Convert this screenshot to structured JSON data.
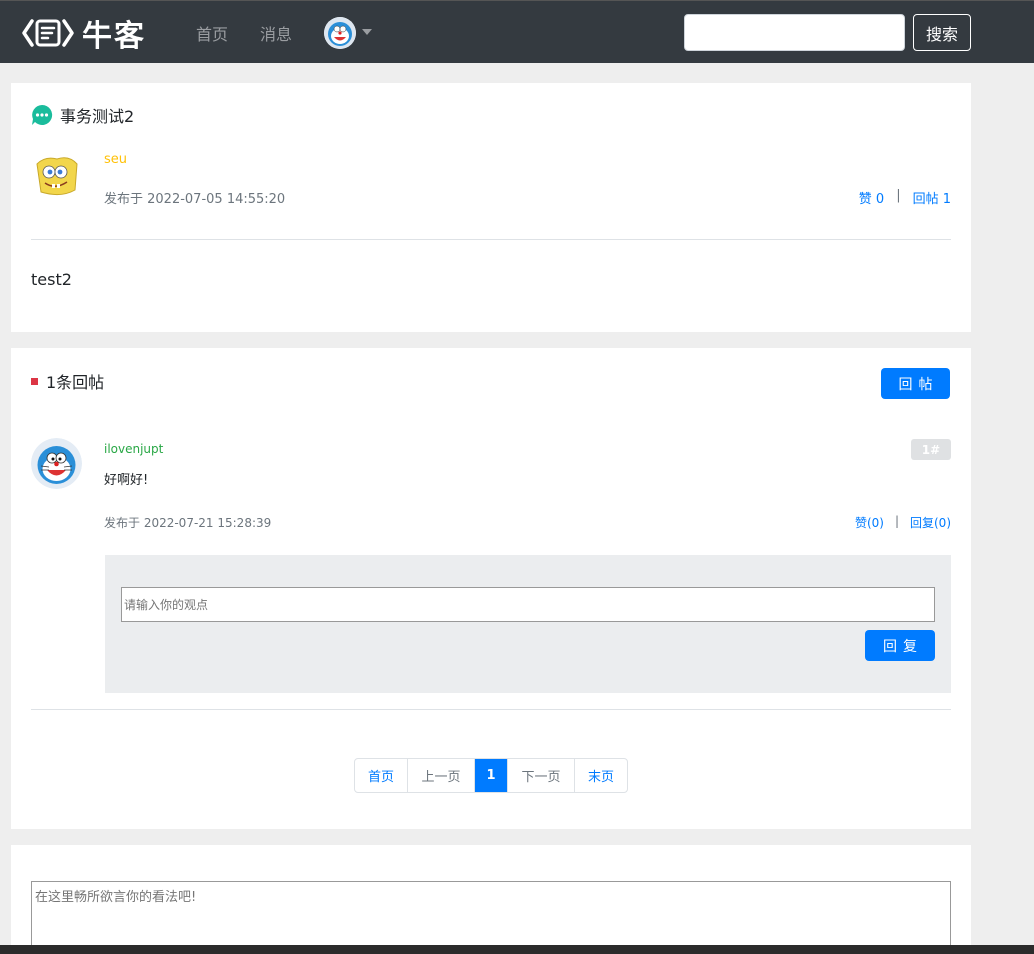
{
  "header": {
    "logo_text": "牛客",
    "nav": {
      "home": "首页",
      "messages": "消息"
    },
    "search": {
      "placeholder": "",
      "button_label": "搜索"
    }
  },
  "post": {
    "title": "事务测试2",
    "author": "seu",
    "published": "发布于 2022-07-05 14:55:20",
    "likes_label": "赞 0",
    "replies_label": "回帖 1",
    "separator": "|",
    "content": "test2"
  },
  "comments_section": {
    "count_label": "1条回帖",
    "reply_button": "回帖",
    "items": [
      {
        "user": "ilovenjupt",
        "floor": "1#",
        "text": "好啊好!",
        "published": "发布于 2022-07-21 15:28:39",
        "likes_label": "赞(0)",
        "reply_label": "回复(0)",
        "separator": "|"
      }
    ],
    "reply_box": {
      "placeholder": "请输入你的观点",
      "button": "回复"
    }
  },
  "pagination": {
    "first": "首页",
    "prev": "上一页",
    "current": "1",
    "next": "下一页",
    "last": "末页"
  },
  "comment_form": {
    "placeholder": "在这里畅所欲言你的看法吧!"
  },
  "colors": {
    "header_bg": "#343a40",
    "primary": "#007bff",
    "author": "#ffc107",
    "commenter": "#28a745",
    "accent_red": "#dc3545",
    "chat_icon": "#1abc9c"
  }
}
